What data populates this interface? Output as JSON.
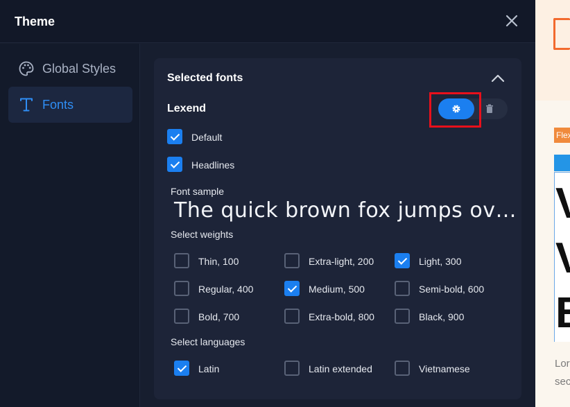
{
  "header": {
    "title": "Theme"
  },
  "sidebar": {
    "items": [
      {
        "label": "Global Styles",
        "icon": "palette-icon",
        "active": false
      },
      {
        "label": "Fonts",
        "icon": "type-icon",
        "active": true
      }
    ]
  },
  "card": {
    "title": "Selected fonts",
    "font_name": "Lexend",
    "usage": [
      {
        "label": "Default",
        "checked": true
      },
      {
        "label": "Headlines",
        "checked": true
      }
    ],
    "sample_label": "Font sample",
    "sample_text": "The quick brown fox jumps ov…",
    "weights_label": "Select weights",
    "weights": [
      {
        "label": "Thin, 100",
        "checked": false
      },
      {
        "label": "Extra-light, 200",
        "checked": false
      },
      {
        "label": "Light, 300",
        "checked": true
      },
      {
        "label": "Regular, 400",
        "checked": false
      },
      {
        "label": "Medium, 500",
        "checked": true
      },
      {
        "label": "Semi-bold, 600",
        "checked": false
      },
      {
        "label": "Bold, 700",
        "checked": false
      },
      {
        "label": "Extra-bold, 800",
        "checked": false
      },
      {
        "label": "Black, 900",
        "checked": false
      }
    ],
    "languages_label": "Select languages",
    "languages": [
      {
        "label": "Latin",
        "checked": true
      },
      {
        "label": "Latin extended",
        "checked": false
      },
      {
        "label": "Vietnamese",
        "checked": false
      }
    ]
  },
  "preview": {
    "tag": "Flex",
    "big_letters": [
      "V",
      "V",
      "B"
    ],
    "body_lines": [
      "Lor",
      "sec"
    ]
  },
  "colors": {
    "accent": "#1b7ff0",
    "highlight": "#e8101b",
    "brand_orange": "#f26a2e"
  }
}
